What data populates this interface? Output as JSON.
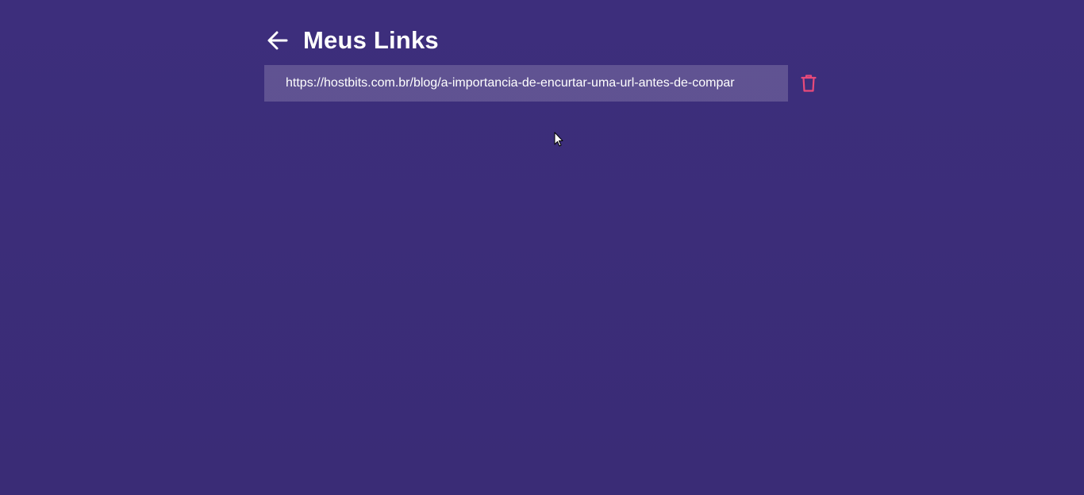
{
  "header": {
    "back_icon": "arrow-left-icon",
    "title": "Meus Links"
  },
  "links": [
    {
      "url": "https://hostbits.com.br/blog/a-importancia-de-encurtar-uma-url-antes-de-compar",
      "delete_icon": "trash-icon"
    }
  ],
  "colors": {
    "background": "#3b2d7a",
    "link_background": "rgba(255,255,255,0.18)",
    "delete_icon": "#e84a7a",
    "text": "#ffffff"
  }
}
